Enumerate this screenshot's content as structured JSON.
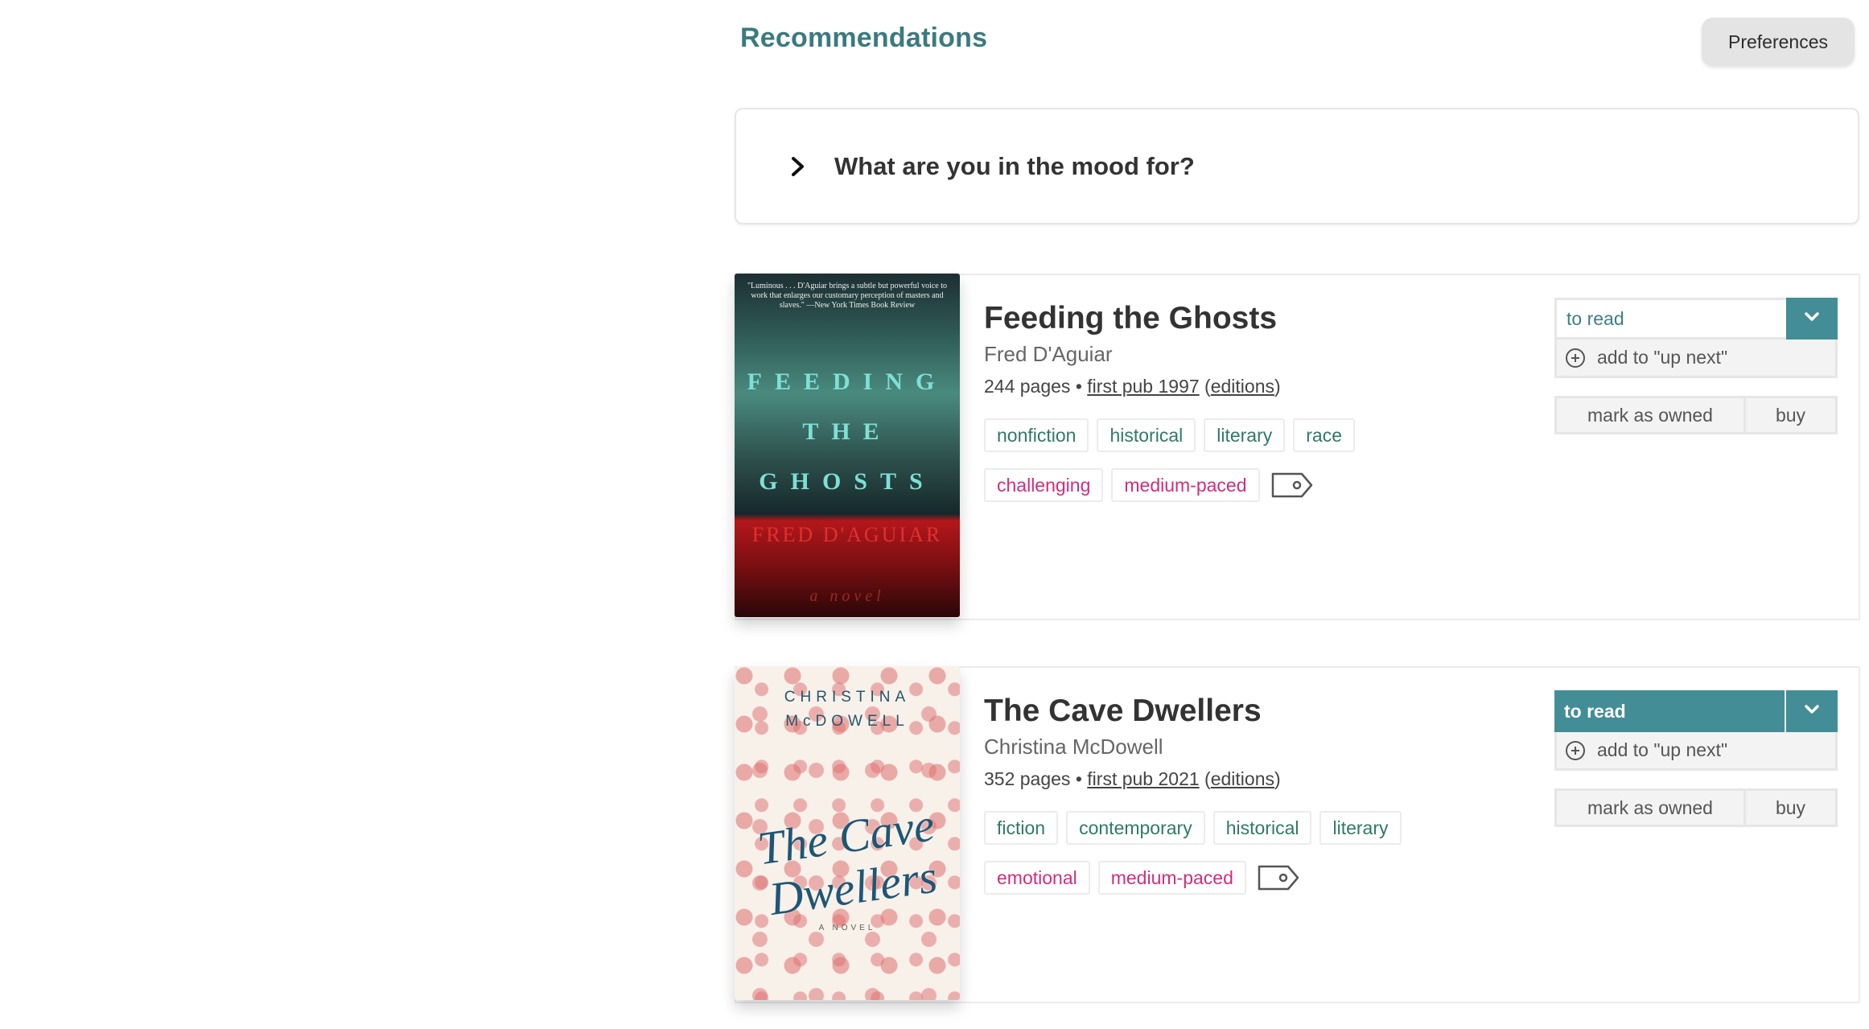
{
  "header": {
    "title": "Recommendations",
    "preferences_label": "Preferences"
  },
  "mood": {
    "label": "What are you in the mood for?",
    "icon": "chevron-right-icon"
  },
  "colors": {
    "accent": "#438d96",
    "title_teal": "#3b7a80",
    "genre_tag": "#2f7a64",
    "mood_tag": "#d12d7e"
  },
  "books": [
    {
      "title": "Feeding the Ghosts",
      "author": "Fred D'Aguiar",
      "pages": "244 pages",
      "separator": "•",
      "first_pub": "first pub 1997",
      "editions": "editions",
      "genre_tags": [
        "nonfiction",
        "historical",
        "literary",
        "race"
      ],
      "mood_tags": [
        "challenging",
        "medium-paced"
      ],
      "status": "to read",
      "status_filled": false,
      "up_next": "add to \"up next\"",
      "owned_label": "mark as owned",
      "buy_label": "buy",
      "cover": {
        "quote": "\"Luminous . . . D'Aguiar brings a subtle but powerful voice to work that enlarges our customary perception of masters and slaves.\" —New York Times Book Review",
        "title_lines": [
          "FEEDING",
          "THE",
          "GHOSTS"
        ],
        "author": "FRED D'AGUIAR",
        "subtitle": "a novel"
      }
    },
    {
      "title": "The Cave Dwellers",
      "author": "Christina McDowell",
      "pages": "352 pages",
      "separator": "•",
      "first_pub": "first pub 2021",
      "editions": "editions",
      "genre_tags": [
        "fiction",
        "contemporary",
        "historical",
        "literary"
      ],
      "mood_tags": [
        "emotional",
        "medium-paced"
      ],
      "status": "to read",
      "status_filled": true,
      "up_next": "add to \"up next\"",
      "owned_label": "mark as owned",
      "buy_label": "buy",
      "cover": {
        "author_lines": [
          "CHRISTINA",
          "McDOWELL"
        ],
        "title_lines": [
          "The Cave",
          "Dwellers"
        ],
        "subtitle": "A NOVEL"
      }
    }
  ]
}
